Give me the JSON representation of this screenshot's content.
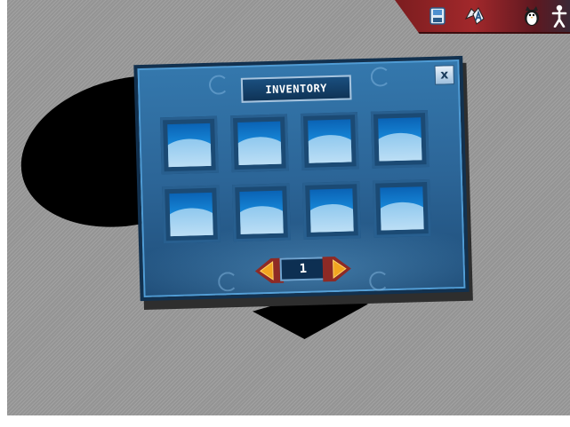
{
  "toolbar": {
    "buttons": [
      {
        "name": "save-icon"
      },
      {
        "name": "card-deck-icon"
      },
      {
        "name": "penguin-icon"
      },
      {
        "name": "player-figure-icon"
      }
    ]
  },
  "inventory": {
    "title": "INVENTORY",
    "close_label": "x",
    "slots": [
      {},
      {},
      {},
      {},
      {},
      {},
      {},
      {}
    ],
    "page": "1",
    "colors": {
      "panel": "#2c6597",
      "frame": "#12314f",
      "arrow": "#f2a521",
      "toolbar": "#a2282b"
    }
  }
}
